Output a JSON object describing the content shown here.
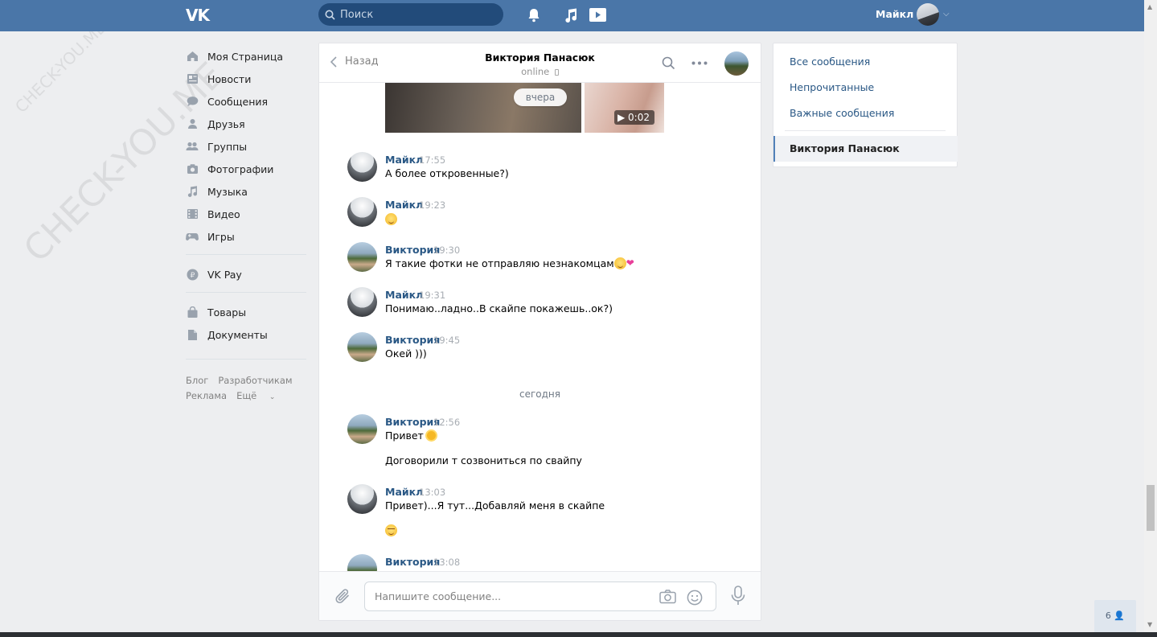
{
  "header": {
    "logo": "VK",
    "search_placeholder": "Поиск",
    "user_name": "Майкл"
  },
  "watermark": {
    "text": "CHECK-YOU.ME"
  },
  "left_menu": {
    "items": [
      {
        "label": "Моя Страница",
        "icon": "home-icon"
      },
      {
        "label": "Новости",
        "icon": "news-icon"
      },
      {
        "label": "Сообщения",
        "icon": "messages-icon"
      },
      {
        "label": "Друзья",
        "icon": "friends-icon"
      },
      {
        "label": "Группы",
        "icon": "groups-icon"
      },
      {
        "label": "Фотографии",
        "icon": "photos-icon"
      },
      {
        "label": "Музыка",
        "icon": "music-icon"
      },
      {
        "label": "Видео",
        "icon": "video-icon"
      },
      {
        "label": "Игры",
        "icon": "games-icon"
      }
    ],
    "pay": {
      "label": "VK Pay",
      "icon": "vkpay-icon"
    },
    "extra": [
      {
        "label": "Товары",
        "icon": "goods-icon"
      },
      {
        "label": "Документы",
        "icon": "documents-icon"
      }
    ],
    "footer": {
      "blog": "Блог",
      "devs": "Разработчикам",
      "ads": "Реклама",
      "more": "Ещё"
    }
  },
  "chat": {
    "back_label": "Назад",
    "peer_name": "Виктория Панасюк",
    "peer_status": "online",
    "media": {
      "day_pill": "вчера",
      "video_duration": "0:02"
    },
    "day_today": "сегодня",
    "messages": [
      {
        "author": "Майкл",
        "time": "17:55",
        "text": "А более откровенные?)"
      },
      {
        "author": "Майкл",
        "time": "19:23",
        "text": ""
      },
      {
        "author": "Виктория",
        "time": "19:30",
        "text": "Я такие фотки не отправляю незнакомцам"
      },
      {
        "author": "Майкл",
        "time": "19:31",
        "text": "Понимаю..ладно..В скайпе покажешь..ок?)"
      },
      {
        "author": "Виктория",
        "time": "19:45",
        "text": "Окей )))"
      },
      {
        "author": "Виктория",
        "time": "12:56",
        "text": "Привет",
        "text2": "Договорили т созвониться по свайпу"
      },
      {
        "author": "Майкл",
        "time": "13:03",
        "text": "Привет)...Я тут...Добавляй меня в скайпе"
      },
      {
        "author": "Виктория",
        "time": "13:08",
        "text": ""
      }
    ],
    "input_placeholder": "Напишите сообщение..."
  },
  "filters": {
    "all": "Все сообщения",
    "unread": "Непрочитанные",
    "important": "Важные сообщения",
    "active_dialog": "Виктория Панасюк"
  },
  "online_count": "6",
  "colors": {
    "header_bg": "#4a76a8",
    "link": "#2a5885",
    "page_bg": "#edeef0"
  }
}
